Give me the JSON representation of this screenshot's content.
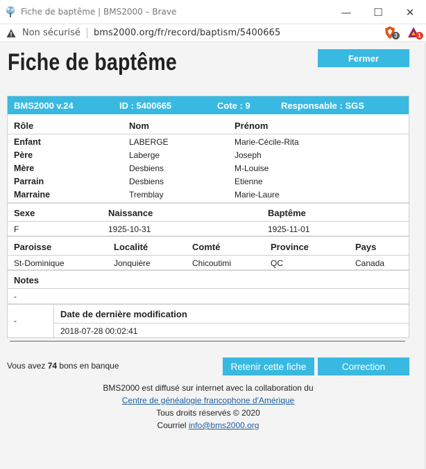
{
  "window": {
    "title": "Fiche de baptême | BMS2000 – Brave",
    "controls": {
      "minimize": "—",
      "maximize": "☐",
      "close": "✕"
    }
  },
  "address_bar": {
    "security_label": "Non sécurisé",
    "url": "bms2000.org/fr/record/baptism/5400665",
    "extensions": [
      {
        "name": "brave-shield-icon",
        "badge": "3",
        "color": "#e05a1a",
        "badge_color": "#555555"
      },
      {
        "name": "brave-rewards-icon",
        "badge": "1",
        "color": "#9e1f63",
        "badge_color": "#e03a2a"
      }
    ]
  },
  "page": {
    "title": "Fiche de baptême",
    "close_button": "Fermer",
    "header": {
      "version": "BMS2000 v.24",
      "id": "ID : 5400665",
      "cote": "Cote : 9",
      "responsable": "Responsable : SGS"
    },
    "people_table": {
      "headers": [
        "Rôle",
        "Nom",
        "Prénom"
      ],
      "rows": [
        {
          "role": "Enfant",
          "nom": "LABERGE",
          "prenom": "Marie-Cécile-Rita"
        },
        {
          "role": "Père",
          "nom": "Laberge",
          "prenom": "Joseph"
        },
        {
          "role": "Mère",
          "nom": "Desbiens",
          "prenom": "M-Louise"
        },
        {
          "role": "Parrain",
          "nom": "Desbiens",
          "prenom": "Etienne"
        },
        {
          "role": "Marraine",
          "nom": "Tremblay",
          "prenom": "Marie-Laure"
        }
      ]
    },
    "birth_table": {
      "headers": [
        "Sexe",
        "Naissance",
        "Baptême"
      ],
      "values": [
        "F",
        "1925-10-31",
        "1925-11-01"
      ]
    },
    "place_table": {
      "headers": [
        "Paroisse",
        "Localité",
        "Comté",
        "Province",
        "Pays"
      ],
      "values": [
        "St-Dominique",
        "Jonquière",
        "Chicoutimi",
        "QC",
        "Canada"
      ]
    },
    "notes": {
      "header": "Notes",
      "value": "-"
    },
    "modification": {
      "left_value": "-",
      "header": "Date de dernière modification",
      "value": "2018-07-28 00:02:41"
    },
    "bank": {
      "prefix": "Vous avez",
      "count": "74",
      "suffix": "bons en banque"
    },
    "buttons": {
      "retain": "Retenir cette fiche",
      "correction": "Correction"
    },
    "footer": {
      "line1": "BMS2000 est diffusé sur internet avec la collaboration du",
      "link1": "Centre de généalogie francophone d'Amérique",
      "line3": "Tous droits réservés © 2020",
      "line4_prefix": "Courriel",
      "email": "info@bms2000.org"
    }
  }
}
